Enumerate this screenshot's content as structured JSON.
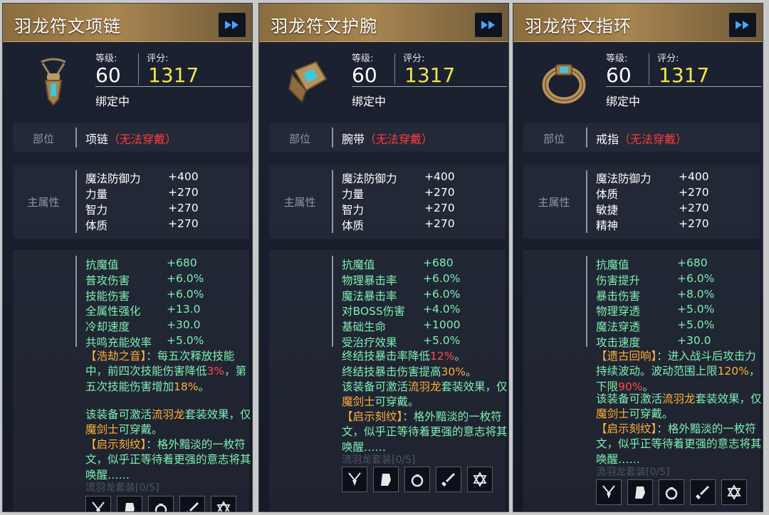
{
  "panels": [
    {
      "title": "羽龙符文项链",
      "level_label": "等级:",
      "level": "60",
      "score_label": "评分:",
      "score": "1317",
      "bind_status": "绑定中",
      "slot_label": "部位",
      "slot_name": "项链",
      "slot_note": "（无法穿戴）",
      "main_label": "主属性",
      "main_stats": [
        {
          "name": "魔法防御力",
          "value": "+400"
        },
        {
          "name": "力量",
          "value": "+270"
        },
        {
          "name": "智力",
          "value": "+270"
        },
        {
          "name": "体质",
          "value": "+270"
        }
      ],
      "extra_stats": [
        {
          "name": "抗魔值",
          "value": "+680"
        },
        {
          "name": "普攻伤害",
          "value": "+6.0%"
        },
        {
          "name": "技能伤害",
          "value": "+6.0%"
        },
        {
          "name": "全属性强化",
          "value": "+13.0"
        },
        {
          "name": "冷却速度",
          "value": "+30.0"
        },
        {
          "name": "共鸣充能效率",
          "value": "+5.0%"
        }
      ],
      "special": {
        "name": "【浩劫之音】",
        "t1": "：每五次释放技能中，前四次技能伤害降低",
        "v1": "3%",
        "t2": "，第五次技能伤害增加",
        "v2": "18%",
        "t3": "。"
      },
      "set_desc": {
        "a": "该装备可激活",
        "set": "流羽龙",
        "b": "套装效果，仅",
        "cls": "魔剑士",
        "c": "可穿戴。"
      },
      "rune": {
        "name": "【启示刻纹】",
        "desc": "：格外黯淡的一枚符文，似乎正等待着更强的意志将其唤醒……"
      },
      "set_progress": "流羽龙套装[0/5]"
    },
    {
      "title": "羽龙符文护腕",
      "level_label": "等级:",
      "level": "60",
      "score_label": "评分:",
      "score": "1317",
      "bind_status": "绑定中",
      "slot_label": "部位",
      "slot_name": "腕带",
      "slot_note": "（无法穿戴）",
      "main_label": "主属性",
      "main_stats": [
        {
          "name": "魔法防御力",
          "value": "+400"
        },
        {
          "name": "力量",
          "value": "+270"
        },
        {
          "name": "智力",
          "value": "+270"
        },
        {
          "name": "体质",
          "value": "+270"
        }
      ],
      "extra_stats": [
        {
          "name": "抗魔值",
          "value": "+680"
        },
        {
          "name": "物理暴击率",
          "value": "+6.0%"
        },
        {
          "name": "魔法暴击率",
          "value": "+6.0%"
        },
        {
          "name": "对BOSS伤害",
          "value": "+4.0%"
        },
        {
          "name": "基础生命",
          "value": "+1000"
        },
        {
          "name": "受治疗效果",
          "value": "+5.0%"
        }
      ],
      "special_lines": [
        {
          "text": "终结技暴击率降低",
          "value": "12%",
          "end": "。"
        },
        {
          "text": "终结技暴击伤害提高",
          "value": "30%",
          "end": "。"
        }
      ],
      "set_desc": {
        "a": "该装备可激活",
        "set": "流羽龙",
        "b": "套装效果，仅",
        "cls": "魔剑士",
        "c": "可穿戴。"
      },
      "rune": {
        "name": "【启示刻纹】",
        "desc": "：格外黯淡的一枚符文，似乎正等待着更强的意志将其唤醒……"
      },
      "set_progress": "流羽龙套装[0/5]"
    },
    {
      "title": "羽龙符文指环",
      "level_label": "等级:",
      "level": "60",
      "score_label": "评分:",
      "score": "1317",
      "bind_status": "绑定中",
      "slot_label": "部位",
      "slot_name": "戒指",
      "slot_note": "（无法穿戴）",
      "main_label": "主属性",
      "main_stats": [
        {
          "name": "魔法防御力",
          "value": "+400"
        },
        {
          "name": "体质",
          "value": "+270"
        },
        {
          "name": "敏捷",
          "value": "+270"
        },
        {
          "name": "精神",
          "value": "+270"
        }
      ],
      "extra_stats": [
        {
          "name": "抗魔值",
          "value": "+680"
        },
        {
          "name": "伤害提升",
          "value": "+6.0%"
        },
        {
          "name": "暴击伤害",
          "value": "+8.0%"
        },
        {
          "name": "物理穿透",
          "value": "+5.0%"
        },
        {
          "name": "魔法穿透",
          "value": "+5.0%"
        },
        {
          "name": "攻击速度",
          "value": "+30.0"
        }
      ],
      "special": {
        "name": "【遗古回响】",
        "t1": "：进入战斗后攻击力持续波动。波动范围上限",
        "v1": "120%",
        "t2": "，下限",
        "v2": "90%",
        "t3": "。"
      },
      "set_desc": {
        "a": "该装备可激活",
        "set": "流羽龙",
        "b": "套装效果，仅",
        "cls": "魔剑士",
        "c": "可穿戴。"
      },
      "rune": {
        "name": "【启示刻纹】",
        "desc": "：格外黯淡的一枚符文，似乎正等待着更强的意志将其唤醒……"
      },
      "set_progress": "流羽龙套装[0/5]"
    }
  ],
  "colors": {
    "stat_green": "#7ff0b4",
    "score_yellow": "#f3e54a",
    "set_gold": "#ffb13a",
    "warn_red": "#ff3b3b"
  },
  "icons": {
    "expand": "double-chevron-right-icon",
    "set_slots": [
      "necklace-icon",
      "bracer-icon",
      "ring-icon",
      "sword-icon",
      "star-of-david-icon"
    ]
  }
}
